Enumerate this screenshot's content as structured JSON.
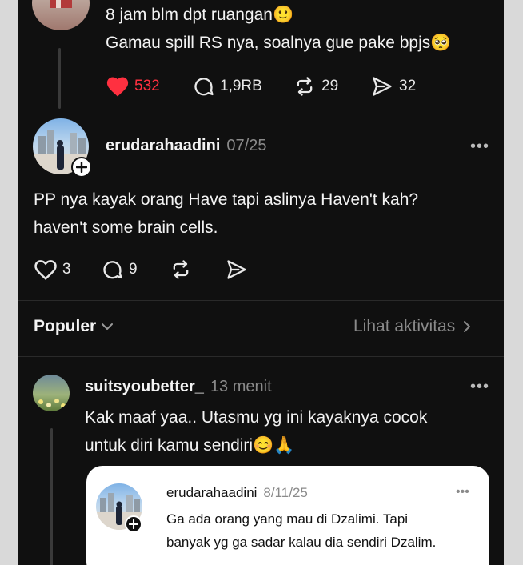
{
  "post1": {
    "line1": "8 jam blm dpt ruangan🙂",
    "line2": "Gamau spill RS nya, soalnya gue pake bpjs🥺",
    "likes": "532",
    "replies": "1,9RB",
    "reposts": "29",
    "shares": "32"
  },
  "post2": {
    "username": "erudarahaadini",
    "time": "07/25",
    "line1": "PP nya kayak orang Have tapi aslinya Haven't kah?",
    "line2": "haven't some brain cells.",
    "likes": "3",
    "replies": "9"
  },
  "sort": {
    "label": "Populer",
    "activity": "Lihat aktivitas"
  },
  "reply": {
    "username": "suitsyoubetter_",
    "time": "13 menit",
    "line1": "Kak maaf yaa.. Utasmu yg ini kayaknya cocok",
    "line2": "untuk diri kamu sendiri😊🙏"
  },
  "quoted": {
    "username": "erudarahaadini",
    "time": "8/11/25",
    "line1": "Ga ada orang yang mau di Dzalimi. Tapi",
    "line2": "banyak yg ga sadar kalau dia sendiri Dzalim."
  },
  "more_label": "•••",
  "colors": {
    "like_red": "#ff3040",
    "background": "#101010"
  },
  "icons": [
    "heart-icon",
    "comment-icon",
    "repost-icon",
    "share-icon",
    "chevron-down-icon",
    "chevron-right-icon",
    "plus-icon",
    "more-icon"
  ]
}
